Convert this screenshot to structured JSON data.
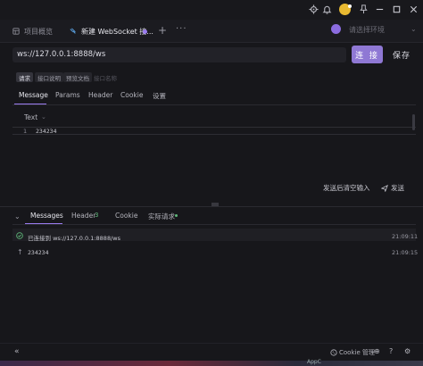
{
  "titlebar": {
    "icons": [
      "gear-icon",
      "bell-icon",
      "shirt-icon",
      "pin-icon",
      "minimize-icon",
      "maximize-icon",
      "close-icon"
    ]
  },
  "tabs": {
    "overview": "项目概览",
    "websocket": "新建 WebSocket 接...",
    "add": "+",
    "more": "···"
  },
  "environment": {
    "placeholder": "请选择环境",
    "arrow": "⌄"
  },
  "url_bar": {
    "value": "ws://127.0.0.1:8888/ws",
    "connect_label": "连 接",
    "save_label": "保存"
  },
  "doc_tabs": {
    "request": "请求",
    "description": "接口说明",
    "preview": "预览文档",
    "name_placeholder": "接口名称"
  },
  "request_tabs": {
    "message": "Message",
    "params": "Params",
    "header": "Header",
    "cookie": "Cookie",
    "settings": "设置"
  },
  "editor": {
    "format": "Text",
    "format_arrow": "⌄",
    "line_number": "1",
    "line_text": "234234"
  },
  "actions": {
    "send_clear": "发送后清空输入",
    "send": "发送"
  },
  "response_tabs": {
    "collapse": "⌄",
    "messages": "Messages",
    "header": "Header",
    "header_count": "3",
    "cookie": "Cookie",
    "actual_request": "实际请求"
  },
  "messages": [
    {
      "icon": "check-circle-icon",
      "text": "已连接到 ws://127.0.0.1:8888/ws",
      "time": "21:09:11"
    },
    {
      "icon": "arrow-up-icon",
      "text": "234234",
      "time": "21:09:15"
    }
  ],
  "statusbar": {
    "expand": "«",
    "cookie_manager": "Cookie 管理",
    "add": "⊕",
    "help": "?",
    "settings": "⚙"
  },
  "taskbar": {
    "label": "AppC"
  },
  "colors": {
    "accent": "#9b7cf0",
    "connect_button": "#8f78d4",
    "success": "#5fb87a"
  }
}
